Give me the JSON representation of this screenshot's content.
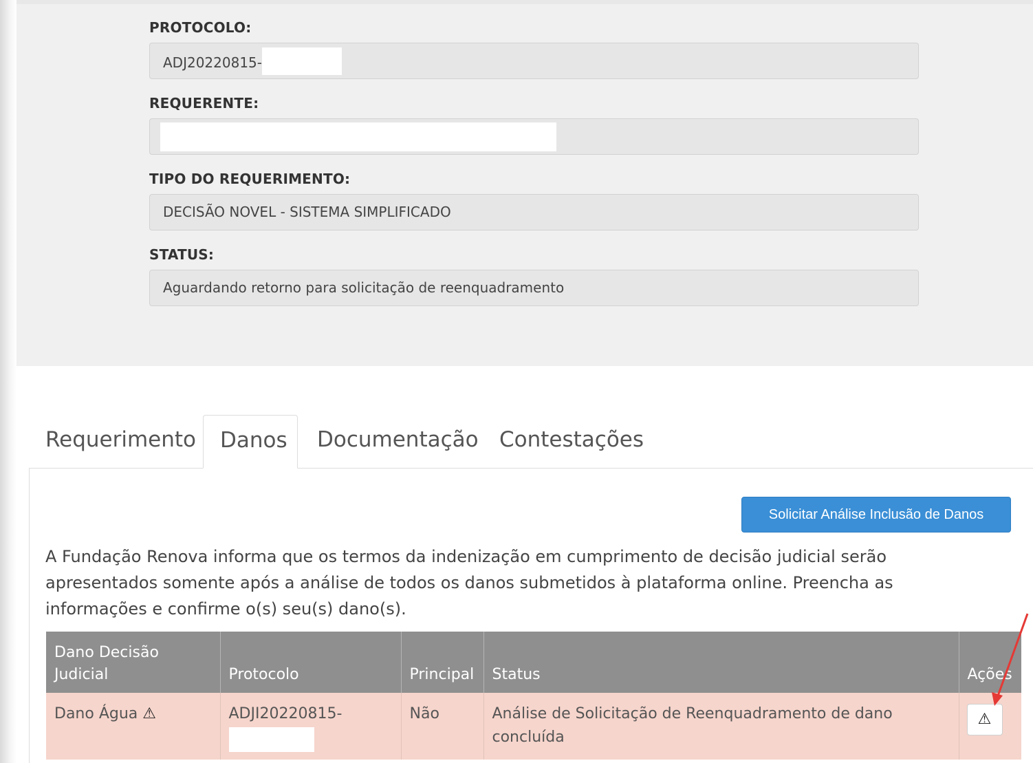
{
  "summary": {
    "protocolo": {
      "label": "PROTOCOLO:",
      "value": "ADJ20220815-"
    },
    "requerente": {
      "label": "REQUERENTE:",
      "value": ""
    },
    "tipo": {
      "label": "TIPO DO REQUERIMENTO:",
      "value": "DECISÃO NOVEL - SISTEMA SIMPLIFICADO"
    },
    "status": {
      "label": "STATUS:",
      "value": "Aguardando retorno para solicitação de reenquadramento"
    }
  },
  "tabs": [
    {
      "label": "Requerimento",
      "active": false
    },
    {
      "label": "Danos",
      "active": true
    },
    {
      "label": "Documentação",
      "active": false
    },
    {
      "label": "Contestações",
      "active": false
    }
  ],
  "danos": {
    "action_button": "Solicitar Análise Inclusão de Danos",
    "notice": "A Fundação Renova informa que os termos da indenização em cumprimento de decisão judicial serão apresentados somente após a análise de todos os danos submetidos à plataforma online. Preencha as informações e confirme o(s) seu(s) dano(s).",
    "table": {
      "headers": [
        "Dano Decisão Judicial",
        "Protocolo",
        "Principal",
        "Status",
        "Ações"
      ],
      "rows": [
        {
          "dano": "Dano Água",
          "protocolo": "ADJI20220815-",
          "principal": "Não",
          "status": "Análise de Solicitação de Reenquadramento de dano concluída",
          "action_icon": "warning-icon"
        }
      ]
    }
  },
  "colors": {
    "primary_button": "#3a8fd6",
    "table_header": "#8f8f8f",
    "row_highlight": "#f6d5cc",
    "annotation_arrow": "#e53935"
  }
}
